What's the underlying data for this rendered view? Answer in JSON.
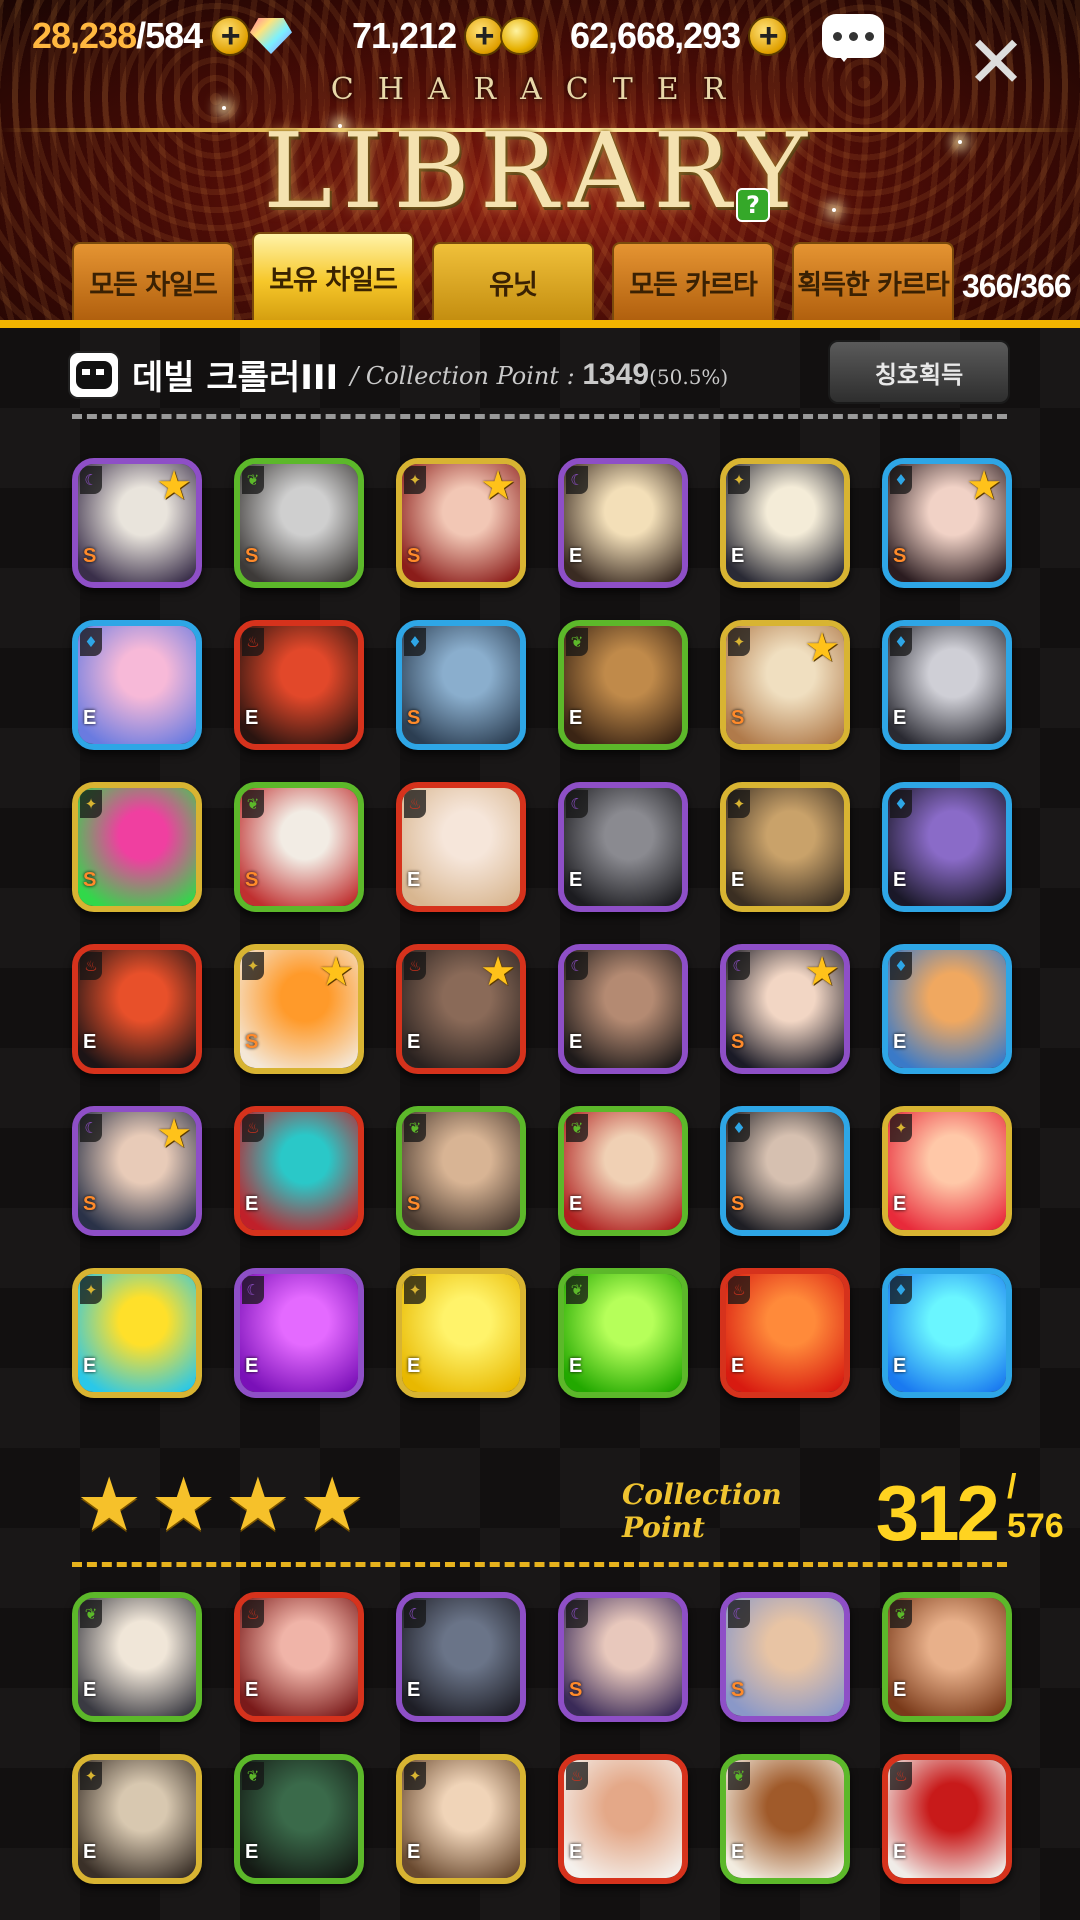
{
  "resources": {
    "stamina": {
      "current": "28,238",
      "max": "/584",
      "icon": "stamina-icon"
    },
    "gems": {
      "value": "71,212",
      "icon": "gem-icon"
    },
    "gold": {
      "value": "62,668,293",
      "icon": "coin-icon"
    }
  },
  "header": {
    "subtitle": "CHARACTER",
    "title": "LIBRARY",
    "help_label": "?"
  },
  "tabs": [
    {
      "label": "모든 차일드",
      "active": false
    },
    {
      "label": "보유 차일드",
      "active": true
    },
    {
      "label": "유닛",
      "active": false
    },
    {
      "label": "모든 카르타",
      "active": false
    },
    {
      "label": "획득한 카르타",
      "active": false
    }
  ],
  "collection_count": "366/366",
  "section1": {
    "name": "데빌 크롤러III",
    "cp_label": "/ Collection Point : ",
    "cp_value": "1349",
    "cp_percent": "(50.5%)",
    "button": "칭호획득"
  },
  "section2": {
    "stars": 4,
    "cp_label": "Collection Point",
    "cp_value": "312",
    "cp_max": "/ 576"
  },
  "colors": {
    "purple": "#8e4fc7",
    "green": "#5cb82a",
    "gold": "#d8b432",
    "blue": "#2ea6e6",
    "red": "#d6321c"
  },
  "cards1": [
    {
      "border": "purple",
      "element": "☾",
      "grade": "S",
      "star": true,
      "art": [
        "#e9e4dc",
        "#3a2f4a"
      ]
    },
    {
      "border": "green",
      "element": "❦",
      "grade": "S",
      "star": false,
      "art": [
        "#cfcfcf",
        "#3d3a38"
      ]
    },
    {
      "border": "gold",
      "element": "✦",
      "grade": "S",
      "star": true,
      "art": [
        "#f2c7b5",
        "#8b1d1a"
      ]
    },
    {
      "border": "purple",
      "element": "☾",
      "grade": "E",
      "star": false,
      "art": [
        "#f3dfb8",
        "#3a2b22"
      ]
    },
    {
      "border": "gold",
      "element": "✦",
      "grade": "E",
      "star": false,
      "art": [
        "#f4ecd8",
        "#2a2a35"
      ]
    },
    {
      "border": "blue",
      "element": "♦",
      "grade": "S",
      "star": true,
      "art": [
        "#f1d2c6",
        "#2b1c20"
      ]
    },
    {
      "border": "blue",
      "element": "♦",
      "grade": "E",
      "star": false,
      "art": [
        "#f7b9d8",
        "#6a7be0"
      ]
    },
    {
      "border": "red",
      "element": "♨",
      "grade": "E",
      "star": false,
      "art": [
        "#e2482a",
        "#2a1410"
      ]
    },
    {
      "border": "blue",
      "element": "♦",
      "grade": "S",
      "star": false,
      "art": [
        "#8aaecd",
        "#2c3e52"
      ]
    },
    {
      "border": "green",
      "element": "❦",
      "grade": "E",
      "star": false,
      "art": [
        "#c08a4a",
        "#3a2414"
      ]
    },
    {
      "border": "gold",
      "element": "✦",
      "grade": "S",
      "star": true,
      "art": [
        "#f0dfc0",
        "#b07a4a"
      ]
    },
    {
      "border": "blue",
      "element": "♦",
      "grade": "E",
      "star": false,
      "art": [
        "#cfcfd6",
        "#2a2a32"
      ]
    },
    {
      "border": "gold",
      "element": "✦",
      "grade": "S",
      "star": false,
      "art": [
        "#f03fa0",
        "#31d84a"
      ]
    },
    {
      "border": "green",
      "element": "❦",
      "grade": "S",
      "star": false,
      "art": [
        "#f2ece4",
        "#c03030"
      ]
    },
    {
      "border": "red",
      "element": "♨",
      "grade": "E",
      "star": false,
      "art": [
        "#f6e6da",
        "#d8b690"
      ]
    },
    {
      "border": "purple",
      "element": "☾",
      "grade": "E",
      "star": false,
      "art": [
        "#8a8a90",
        "#1c1c20"
      ]
    },
    {
      "border": "gold",
      "element": "✦",
      "grade": "E",
      "star": false,
      "art": [
        "#c9a26a",
        "#3a2e22"
      ]
    },
    {
      "border": "blue",
      "element": "♦",
      "grade": "E",
      "star": false,
      "art": [
        "#8a6bc8",
        "#1a1828"
      ]
    },
    {
      "border": "red",
      "element": "♨",
      "grade": "E",
      "star": false,
      "art": [
        "#e8502a",
        "#1c1416"
      ]
    },
    {
      "border": "gold",
      "element": "✦",
      "grade": "S",
      "star": true,
      "art": [
        "#ff9a2a",
        "#f4e7d6"
      ]
    },
    {
      "border": "red",
      "element": "♨",
      "grade": "E",
      "star": true,
      "art": [
        "#8a6a58",
        "#2a2220"
      ]
    },
    {
      "border": "purple",
      "element": "☾",
      "grade": "E",
      "star": false,
      "art": [
        "#b48a72",
        "#1e1a1a"
      ]
    },
    {
      "border": "purple",
      "element": "☾",
      "grade": "S",
      "star": true,
      "art": [
        "#f2d6c4",
        "#1a1a26"
      ]
    },
    {
      "border": "blue",
      "element": "♦",
      "grade": "E",
      "star": false,
      "art": [
        "#f0a860",
        "#3a7ac8"
      ]
    },
    {
      "border": "purple",
      "element": "☾",
      "grade": "S",
      "star": true,
      "art": [
        "#e8cbb8",
        "#2a3248"
      ]
    },
    {
      "border": "red",
      "element": "♨",
      "grade": "E",
      "star": false,
      "art": [
        "#2ac8c8",
        "#c0202a"
      ]
    },
    {
      "border": "green",
      "element": "❦",
      "grade": "S",
      "star": false,
      "art": [
        "#d8b494",
        "#4a3a30"
      ]
    },
    {
      "border": "green",
      "element": "❦",
      "grade": "E",
      "star": false,
      "art": [
        "#f0d0b4",
        "#b02020"
      ]
    },
    {
      "border": "blue",
      "element": "♦",
      "grade": "S",
      "star": false,
      "art": [
        "#d6c0b0",
        "#1e1e24"
      ]
    },
    {
      "border": "gold",
      "element": "✦",
      "grade": "E",
      "star": false,
      "art": [
        "#ffc8a8",
        "#e82a3a"
      ]
    },
    {
      "border": "gold",
      "element": "✦",
      "grade": "E",
      "star": false,
      "art": [
        "#ffe02a",
        "#2ac8e8"
      ]
    },
    {
      "border": "purple",
      "element": "☾",
      "grade": "E",
      "star": false,
      "art": [
        "#e46aff",
        "#7a10b8"
      ]
    },
    {
      "border": "gold",
      "element": "✦",
      "grade": "E",
      "star": false,
      "art": [
        "#fff36a",
        "#e8b800"
      ]
    },
    {
      "border": "green",
      "element": "❦",
      "grade": "E",
      "star": false,
      "art": [
        "#b6ff5a",
        "#22a800"
      ]
    },
    {
      "border": "red",
      "element": "♨",
      "grade": "E",
      "star": false,
      "art": [
        "#ff8a3a",
        "#d81a10"
      ]
    },
    {
      "border": "blue",
      "element": "♦",
      "grade": "E",
      "star": false,
      "art": [
        "#6af6ff",
        "#1a7af0"
      ]
    }
  ],
  "cards2": [
    {
      "border": "green",
      "element": "❦",
      "grade": "E",
      "star": false,
      "art": [
        "#f0e6d8",
        "#3a3a42"
      ]
    },
    {
      "border": "red",
      "element": "♨",
      "grade": "E",
      "star": false,
      "art": [
        "#f0b4a8",
        "#7a1a1a"
      ]
    },
    {
      "border": "purple",
      "element": "☾",
      "grade": "E",
      "star": false,
      "art": [
        "#6a7488",
        "#1e1e26"
      ]
    },
    {
      "border": "purple",
      "element": "☾",
      "grade": "S",
      "star": false,
      "art": [
        "#e8c8bc",
        "#3a2a58"
      ]
    },
    {
      "border": "purple",
      "element": "☾",
      "grade": "S",
      "star": false,
      "art": [
        "#e8c4a4",
        "#8a98c8"
      ]
    },
    {
      "border": "green",
      "element": "❦",
      "grade": "E",
      "star": false,
      "art": [
        "#e8b08a",
        "#7a3a1a"
      ]
    },
    {
      "border": "gold",
      "element": "✦",
      "grade": "E",
      "star": false,
      "art": [
        "#d8c8b0",
        "#3a3028"
      ]
    },
    {
      "border": "green",
      "element": "❦",
      "grade": "E",
      "star": false,
      "art": [
        "#3a6a4a",
        "#141a14"
      ]
    },
    {
      "border": "gold",
      "element": "✦",
      "grade": "E",
      "star": false,
      "art": [
        "#f0d4b8",
        "#6a4a30"
      ]
    },
    {
      "border": "red",
      "element": "♨",
      "grade": "E",
      "star": false,
      "art": [
        "#e4a888",
        "#f4f0ec"
      ]
    },
    {
      "border": "green",
      "element": "❦",
      "grade": "E",
      "star": false,
      "art": [
        "#a05a2a",
        "#f2ece0"
      ]
    },
    {
      "border": "red",
      "element": "♨",
      "grade": "E",
      "star": false,
      "art": [
        "#c81a1a",
        "#f0ece8"
      ]
    }
  ]
}
